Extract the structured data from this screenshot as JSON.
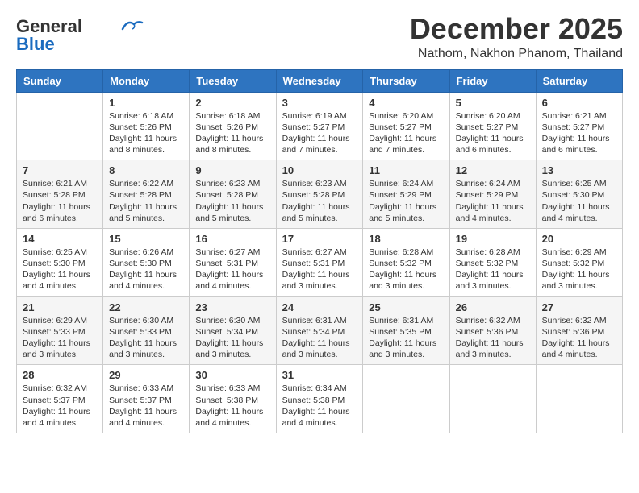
{
  "header": {
    "logo_general": "General",
    "logo_blue": "Blue",
    "month": "December 2025",
    "location": "Nathom, Nakhon Phanom, Thailand"
  },
  "days_of_week": [
    "Sunday",
    "Monday",
    "Tuesday",
    "Wednesday",
    "Thursday",
    "Friday",
    "Saturday"
  ],
  "weeks": [
    [
      {
        "day": "",
        "sunrise": "",
        "sunset": "",
        "daylight": ""
      },
      {
        "day": "1",
        "sunrise": "Sunrise: 6:18 AM",
        "sunset": "Sunset: 5:26 PM",
        "daylight": "Daylight: 11 hours and 8 minutes."
      },
      {
        "day": "2",
        "sunrise": "Sunrise: 6:18 AM",
        "sunset": "Sunset: 5:26 PM",
        "daylight": "Daylight: 11 hours and 8 minutes."
      },
      {
        "day": "3",
        "sunrise": "Sunrise: 6:19 AM",
        "sunset": "Sunset: 5:27 PM",
        "daylight": "Daylight: 11 hours and 7 minutes."
      },
      {
        "day": "4",
        "sunrise": "Sunrise: 6:20 AM",
        "sunset": "Sunset: 5:27 PM",
        "daylight": "Daylight: 11 hours and 7 minutes."
      },
      {
        "day": "5",
        "sunrise": "Sunrise: 6:20 AM",
        "sunset": "Sunset: 5:27 PM",
        "daylight": "Daylight: 11 hours and 6 minutes."
      },
      {
        "day": "6",
        "sunrise": "Sunrise: 6:21 AM",
        "sunset": "Sunset: 5:27 PM",
        "daylight": "Daylight: 11 hours and 6 minutes."
      }
    ],
    [
      {
        "day": "7",
        "sunrise": "Sunrise: 6:21 AM",
        "sunset": "Sunset: 5:28 PM",
        "daylight": "Daylight: 11 hours and 6 minutes."
      },
      {
        "day": "8",
        "sunrise": "Sunrise: 6:22 AM",
        "sunset": "Sunset: 5:28 PM",
        "daylight": "Daylight: 11 hours and 5 minutes."
      },
      {
        "day": "9",
        "sunrise": "Sunrise: 6:23 AM",
        "sunset": "Sunset: 5:28 PM",
        "daylight": "Daylight: 11 hours and 5 minutes."
      },
      {
        "day": "10",
        "sunrise": "Sunrise: 6:23 AM",
        "sunset": "Sunset: 5:28 PM",
        "daylight": "Daylight: 11 hours and 5 minutes."
      },
      {
        "day": "11",
        "sunrise": "Sunrise: 6:24 AM",
        "sunset": "Sunset: 5:29 PM",
        "daylight": "Daylight: 11 hours and 5 minutes."
      },
      {
        "day": "12",
        "sunrise": "Sunrise: 6:24 AM",
        "sunset": "Sunset: 5:29 PM",
        "daylight": "Daylight: 11 hours and 4 minutes."
      },
      {
        "day": "13",
        "sunrise": "Sunrise: 6:25 AM",
        "sunset": "Sunset: 5:30 PM",
        "daylight": "Daylight: 11 hours and 4 minutes."
      }
    ],
    [
      {
        "day": "14",
        "sunrise": "Sunrise: 6:25 AM",
        "sunset": "Sunset: 5:30 PM",
        "daylight": "Daylight: 11 hours and 4 minutes."
      },
      {
        "day": "15",
        "sunrise": "Sunrise: 6:26 AM",
        "sunset": "Sunset: 5:30 PM",
        "daylight": "Daylight: 11 hours and 4 minutes."
      },
      {
        "day": "16",
        "sunrise": "Sunrise: 6:27 AM",
        "sunset": "Sunset: 5:31 PM",
        "daylight": "Daylight: 11 hours and 4 minutes."
      },
      {
        "day": "17",
        "sunrise": "Sunrise: 6:27 AM",
        "sunset": "Sunset: 5:31 PM",
        "daylight": "Daylight: 11 hours and 3 minutes."
      },
      {
        "day": "18",
        "sunrise": "Sunrise: 6:28 AM",
        "sunset": "Sunset: 5:32 PM",
        "daylight": "Daylight: 11 hours and 3 minutes."
      },
      {
        "day": "19",
        "sunrise": "Sunrise: 6:28 AM",
        "sunset": "Sunset: 5:32 PM",
        "daylight": "Daylight: 11 hours and 3 minutes."
      },
      {
        "day": "20",
        "sunrise": "Sunrise: 6:29 AM",
        "sunset": "Sunset: 5:32 PM",
        "daylight": "Daylight: 11 hours and 3 minutes."
      }
    ],
    [
      {
        "day": "21",
        "sunrise": "Sunrise: 6:29 AM",
        "sunset": "Sunset: 5:33 PM",
        "daylight": "Daylight: 11 hours and 3 minutes."
      },
      {
        "day": "22",
        "sunrise": "Sunrise: 6:30 AM",
        "sunset": "Sunset: 5:33 PM",
        "daylight": "Daylight: 11 hours and 3 minutes."
      },
      {
        "day": "23",
        "sunrise": "Sunrise: 6:30 AM",
        "sunset": "Sunset: 5:34 PM",
        "daylight": "Daylight: 11 hours and 3 minutes."
      },
      {
        "day": "24",
        "sunrise": "Sunrise: 6:31 AM",
        "sunset": "Sunset: 5:34 PM",
        "daylight": "Daylight: 11 hours and 3 minutes."
      },
      {
        "day": "25",
        "sunrise": "Sunrise: 6:31 AM",
        "sunset": "Sunset: 5:35 PM",
        "daylight": "Daylight: 11 hours and 3 minutes."
      },
      {
        "day": "26",
        "sunrise": "Sunrise: 6:32 AM",
        "sunset": "Sunset: 5:36 PM",
        "daylight": "Daylight: 11 hours and 3 minutes."
      },
      {
        "day": "27",
        "sunrise": "Sunrise: 6:32 AM",
        "sunset": "Sunset: 5:36 PM",
        "daylight": "Daylight: 11 hours and 4 minutes."
      }
    ],
    [
      {
        "day": "28",
        "sunrise": "Sunrise: 6:32 AM",
        "sunset": "Sunset: 5:37 PM",
        "daylight": "Daylight: 11 hours and 4 minutes."
      },
      {
        "day": "29",
        "sunrise": "Sunrise: 6:33 AM",
        "sunset": "Sunset: 5:37 PM",
        "daylight": "Daylight: 11 hours and 4 minutes."
      },
      {
        "day": "30",
        "sunrise": "Sunrise: 6:33 AM",
        "sunset": "Sunset: 5:38 PM",
        "daylight": "Daylight: 11 hours and 4 minutes."
      },
      {
        "day": "31",
        "sunrise": "Sunrise: 6:34 AM",
        "sunset": "Sunset: 5:38 PM",
        "daylight": "Daylight: 11 hours and 4 minutes."
      },
      {
        "day": "",
        "sunrise": "",
        "sunset": "",
        "daylight": ""
      },
      {
        "day": "",
        "sunrise": "",
        "sunset": "",
        "daylight": ""
      },
      {
        "day": "",
        "sunrise": "",
        "sunset": "",
        "daylight": ""
      }
    ]
  ]
}
